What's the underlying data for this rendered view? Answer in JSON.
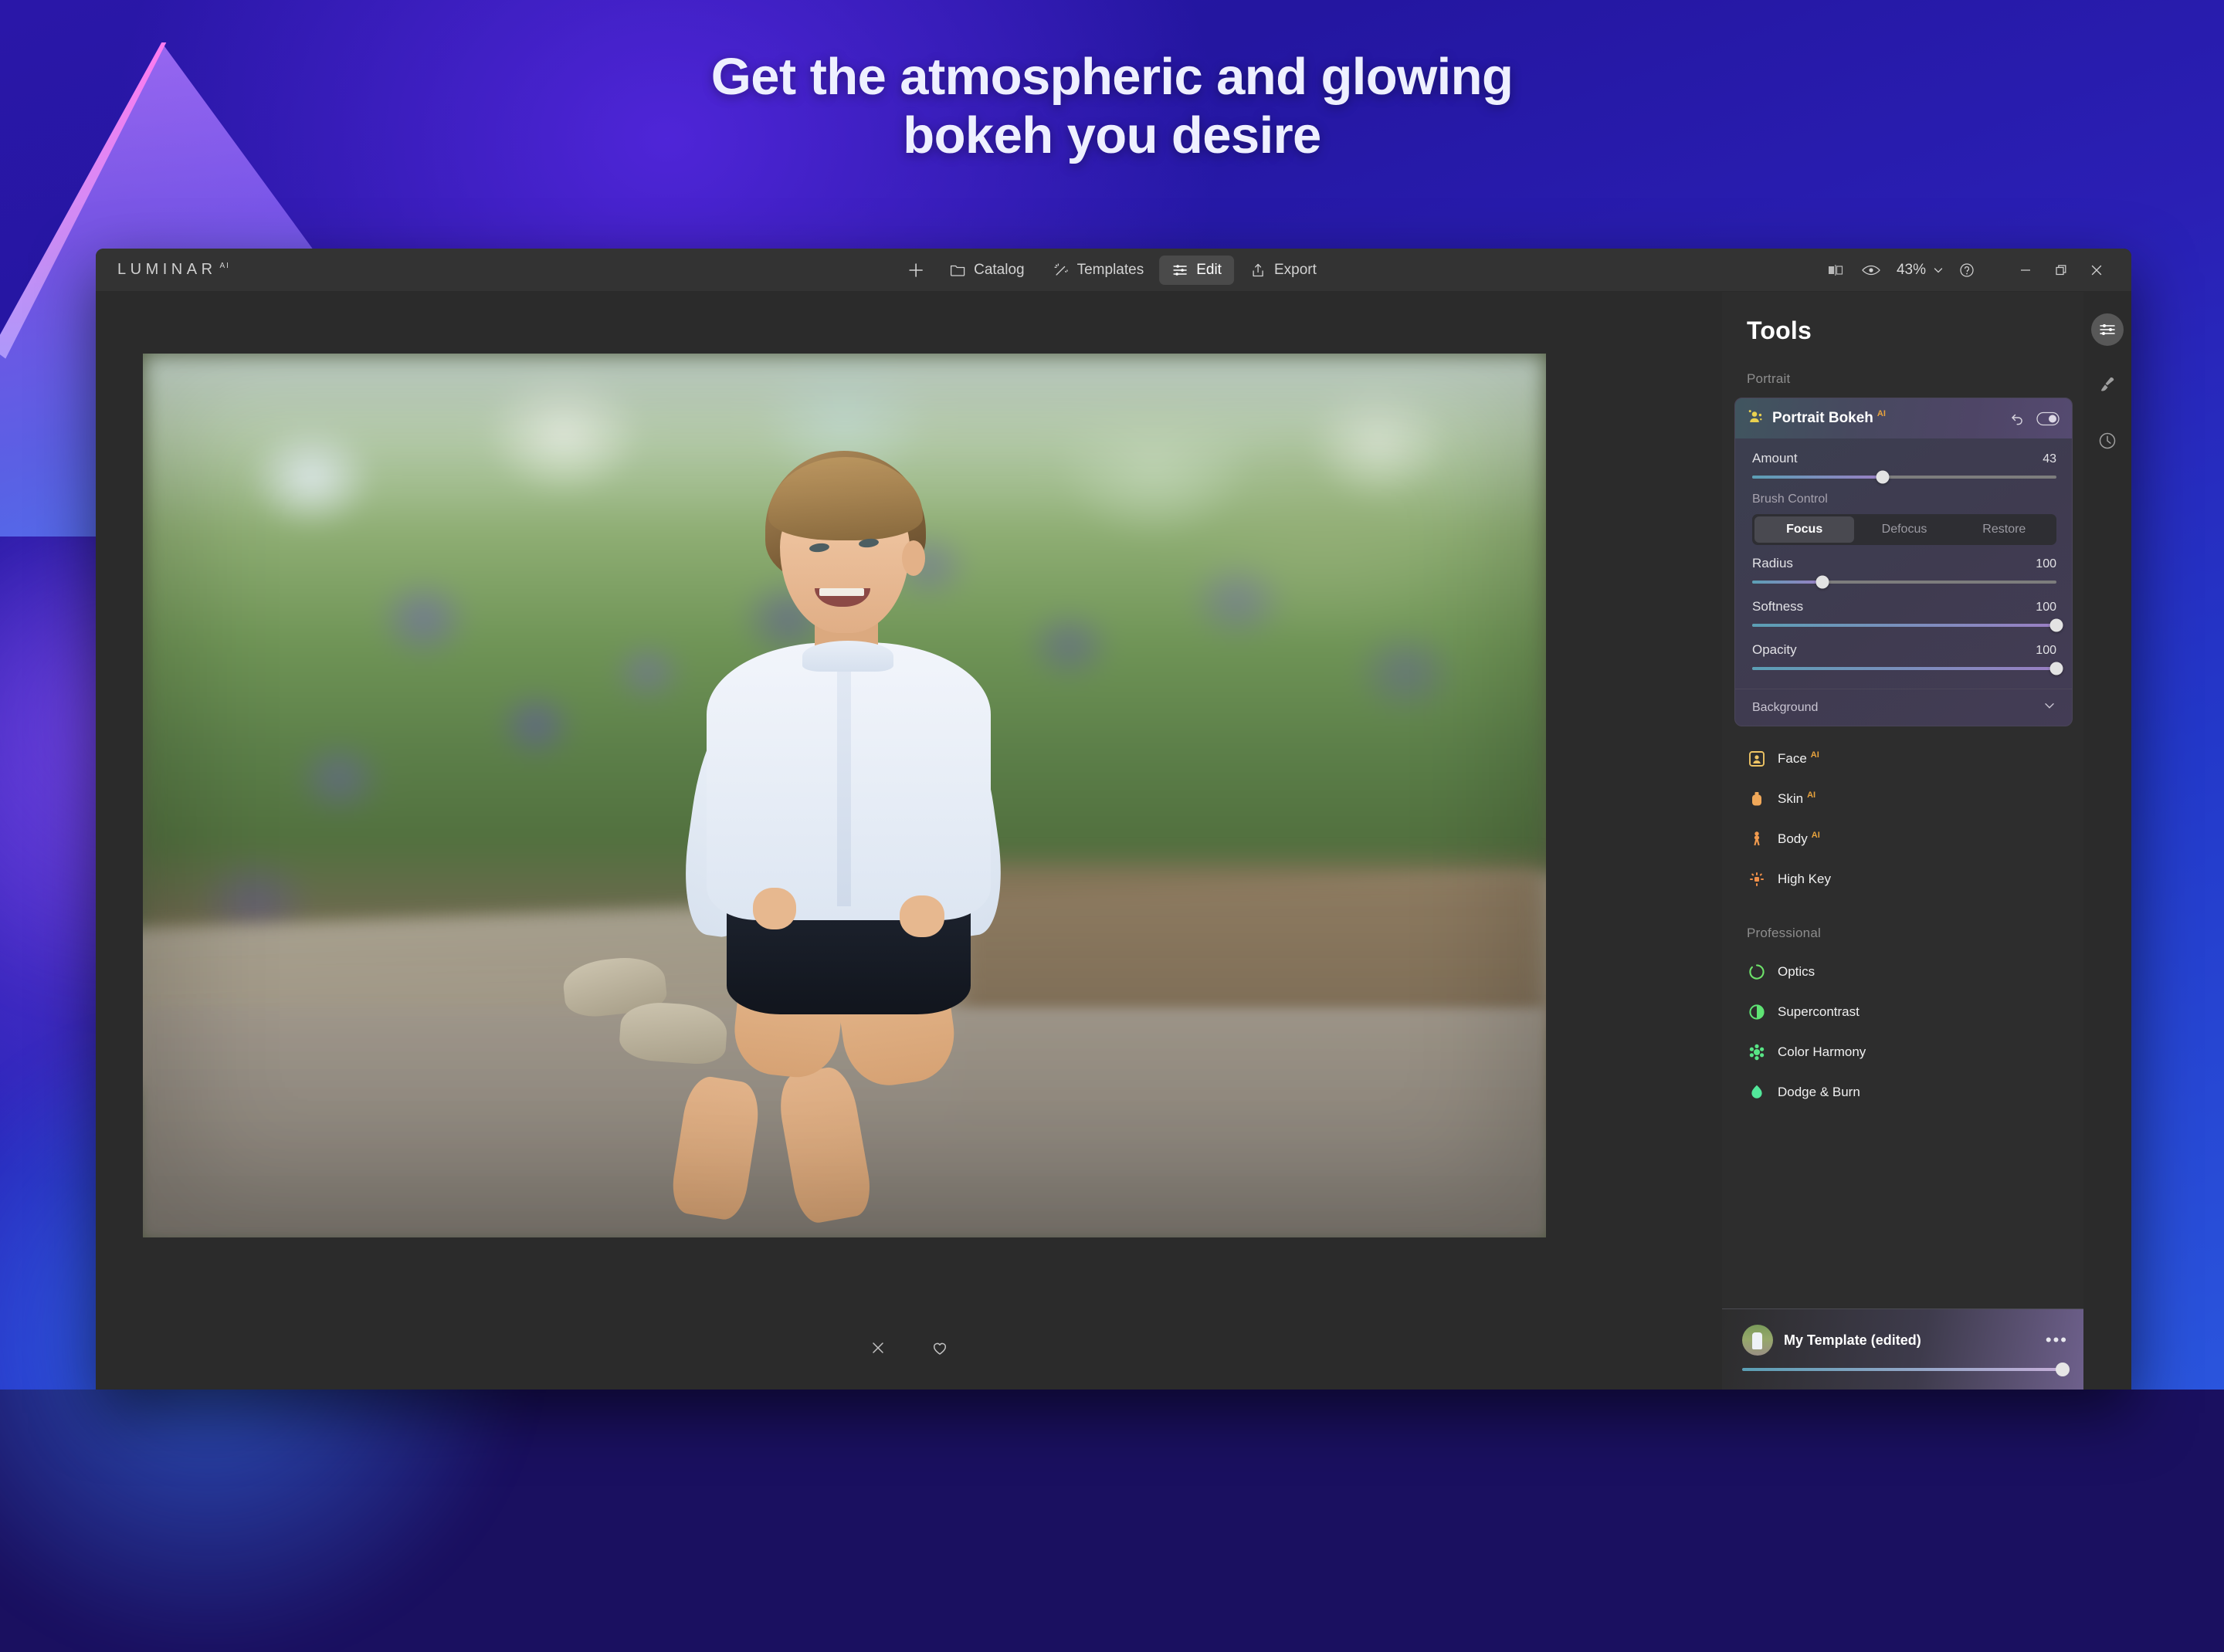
{
  "marketing": {
    "headline_line1": "Get the atmospheric and glowing",
    "headline_line2": "bokeh you desire",
    "bg_start": "#2a17a8",
    "bg_end": "#2a55dd"
  },
  "titlebar": {
    "logo": "LUMINAR",
    "logo_sup": "AI",
    "nav": [
      {
        "label": "",
        "icon": "plus-icon"
      },
      {
        "label": "Catalog",
        "icon": "folder-icon"
      },
      {
        "label": "Templates",
        "icon": "wand-icon"
      },
      {
        "label": "Edit",
        "icon": "sliders-icon"
      },
      {
        "label": "Export",
        "icon": "share-icon"
      }
    ],
    "active_nav": "Edit",
    "compare_icon": "compare-icon",
    "preview_icon": "eye-icon",
    "zoom_level": "43%",
    "zoom_caret": "chevron-down-icon",
    "help_icon": "help-icon",
    "minimize": "minimize-icon",
    "maximize": "restore-icon",
    "close": "close-icon"
  },
  "canvas": {
    "bottom_icons": [
      "close-icon",
      "heart-icon"
    ]
  },
  "tools": {
    "title": "Tools",
    "groups": [
      {
        "label": "Portrait"
      },
      {
        "label": "Professional"
      }
    ],
    "bokeh": {
      "name": "Portrait Bokeh",
      "ai_badge": "AI",
      "reset_icon": "undo-icon",
      "toggle_icon": "toggle-on-icon",
      "amount": {
        "label": "Amount",
        "value": "43",
        "percent": 43
      },
      "brush_control_label": "Brush Control",
      "segments": [
        {
          "label": "Focus",
          "selected": true
        },
        {
          "label": "Defocus",
          "selected": false
        },
        {
          "label": "Restore",
          "selected": false
        }
      ],
      "sliders": [
        {
          "label": "Radius",
          "value": "100",
          "percent": 23
        },
        {
          "label": "Softness",
          "value": "100",
          "percent": 100
        },
        {
          "label": "Opacity",
          "value": "100",
          "percent": 100
        }
      ],
      "background_label": "Background",
      "background_caret": "chevron-down-icon"
    },
    "portrait_items": [
      {
        "label": "Face",
        "ai": "AI",
        "icon": "face-icon",
        "color": "#eec464"
      },
      {
        "label": "Skin",
        "ai": "AI",
        "icon": "skin-bottle-icon",
        "color": "#f0a859"
      },
      {
        "label": "Body",
        "ai": "AI",
        "icon": "body-icon",
        "color": "#f09a4e"
      },
      {
        "label": "High Key",
        "ai": "",
        "icon": "high-key-icon",
        "color": "#f08f49"
      }
    ],
    "professional_items": [
      {
        "label": "Optics",
        "ai": "",
        "icon": "optics-icon",
        "color": "#6ee36a"
      },
      {
        "label": "Supercontrast",
        "ai": "",
        "icon": "contrast-icon",
        "color": "#5fe374"
      },
      {
        "label": "Color Harmony",
        "ai": "",
        "icon": "color-harmony-icon",
        "color": "#58e485"
      },
      {
        "label": "Dodge & Burn",
        "ai": "",
        "icon": "dodge-burn-icon",
        "color": "#52e79a"
      }
    ],
    "template": {
      "name": "My Template (edited)",
      "menu_icon": "more-dots-icon",
      "amount_percent": 100
    },
    "rail": [
      {
        "icon": "sliders-icon",
        "active": true
      },
      {
        "icon": "brush-icon",
        "active": false
      },
      {
        "icon": "history-clock-icon",
        "active": false
      }
    ]
  }
}
